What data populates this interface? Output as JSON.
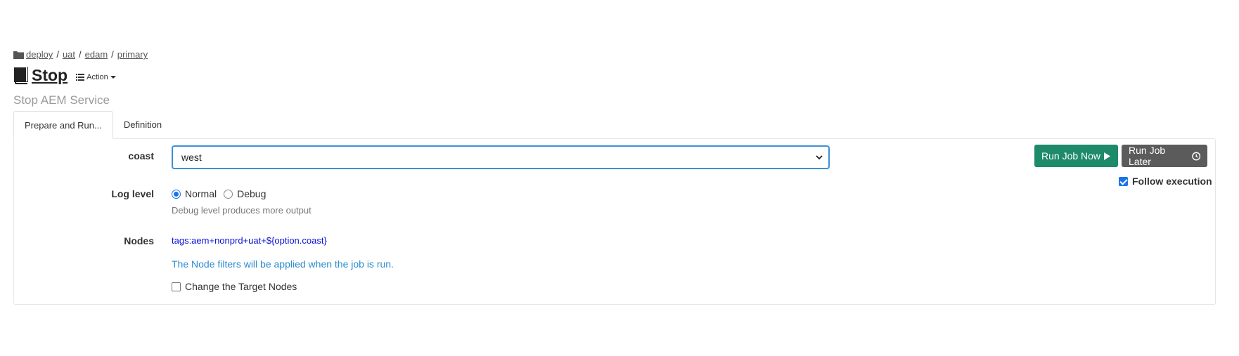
{
  "breadcrumb": {
    "items": [
      "deploy",
      "uat",
      "edam",
      "primary"
    ],
    "separator": "/"
  },
  "job": {
    "title": "Stop",
    "action_label": "Action",
    "description": "Stop AEM Service"
  },
  "tabs": [
    {
      "label": "Prepare and Run...",
      "active": true
    },
    {
      "label": "Definition",
      "active": false
    }
  ],
  "form": {
    "coast": {
      "label": "coast",
      "selected": "west"
    },
    "log_level": {
      "label": "Log level",
      "options": [
        {
          "label": "Normal",
          "checked": true
        },
        {
          "label": "Debug",
          "checked": false
        }
      ],
      "help": "Debug level produces more output"
    },
    "nodes": {
      "label": "Nodes",
      "filter": "tags:aem+nonprd+uat+${option.coast}",
      "note": "The Node filters will be applied when the job is run.",
      "change_target_label": "Change the Target Nodes",
      "change_target_checked": false
    }
  },
  "actions": {
    "run_now": "Run Job Now",
    "run_later": "Run Job Later",
    "follow_execution": "Follow execution",
    "follow_checked": true
  },
  "colors": {
    "run_now_bg": "#1d8a6a",
    "run_later_bg": "#5b5b5b",
    "select_border": "#3d8fd9",
    "filter_link": "#0a12d6",
    "note_text": "#2a8bd1"
  }
}
